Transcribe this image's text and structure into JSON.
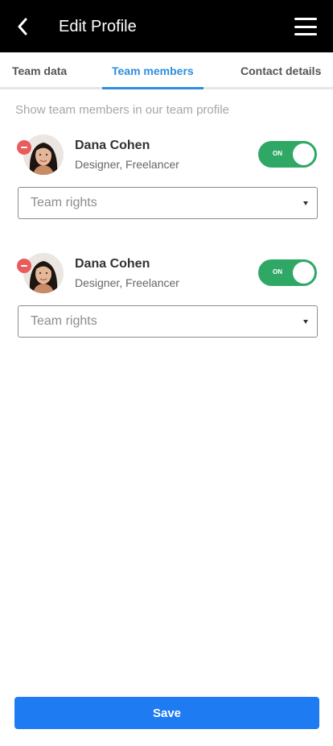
{
  "header": {
    "title": "Edit Profile",
    "back_icon": "back-arrow-icon",
    "menu_icon": "hamburger-menu-icon"
  },
  "tabs": [
    {
      "label": "Team data",
      "active": false
    },
    {
      "label": "Team members",
      "active": true
    },
    {
      "label": "Contact details",
      "active": false
    }
  ],
  "hint": "Show team members in our team profile",
  "members": [
    {
      "name": "Dana Cohen",
      "role": "Designer, Freelancer",
      "toggle_label": "ON",
      "toggle_on": true,
      "rights_placeholder": "Team rights"
    },
    {
      "name": "Dana Cohen",
      "role": "Designer, Freelancer",
      "toggle_label": "ON",
      "toggle_on": true,
      "rights_placeholder": "Team rights"
    }
  ],
  "save_label": "Save",
  "colors": {
    "accent": "#2e8de0",
    "toggle_on": "#2fa866",
    "remove": "#e85c5c",
    "save": "#1f7bf2"
  }
}
